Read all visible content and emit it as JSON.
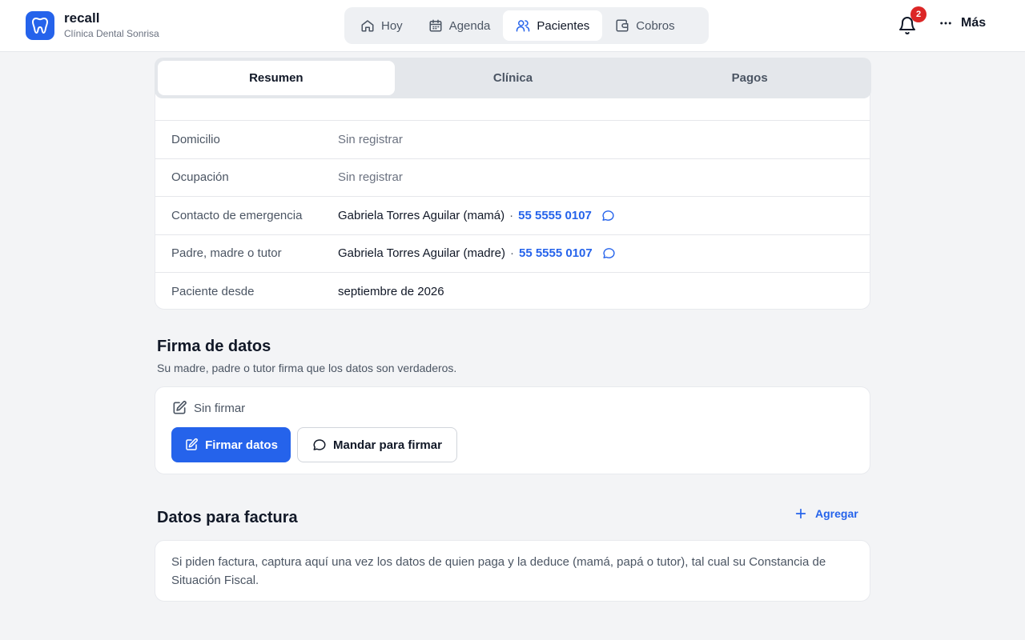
{
  "app": {
    "name": "recall",
    "clinic": "Clínica Dental Sonrisa",
    "logo_icon": "tooth-icon",
    "accent": "#2563eb"
  },
  "nav": {
    "items": [
      {
        "label": "Hoy",
        "icon": "home-icon"
      },
      {
        "label": "Agenda",
        "icon": "calendar-icon"
      },
      {
        "label": "Pacientes",
        "icon": "users-icon",
        "active": true
      },
      {
        "label": "Cobros",
        "icon": "wallet-icon"
      }
    ]
  },
  "header": {
    "notifications_count": "2",
    "more_label": "Más"
  },
  "tabs": [
    {
      "label": "Resumen",
      "active": true
    },
    {
      "label": "Clínica"
    },
    {
      "label": "Pagos"
    }
  ],
  "patient_info": {
    "rows": [
      {
        "label": "Domicilio",
        "value": "Sin registrar",
        "muted": true
      },
      {
        "label": "Ocupación",
        "value": "Sin registrar",
        "muted": true
      },
      {
        "label": "Contacto de emergencia",
        "value": "Gabriela Torres Aguilar (mamá)",
        "separator": "·",
        "phone": "55 5555 0107",
        "icon": "chat-icon"
      },
      {
        "label": "Padre, madre o tutor",
        "value": "Gabriela Torres Aguilar (madre)",
        "separator": "·",
        "phone": "55 5555 0107",
        "icon": "chat-icon"
      },
      {
        "label": "Paciente desde",
        "value": "septiembre de 2026"
      }
    ]
  },
  "signature": {
    "title": "Firma de datos",
    "subtitle": "Su madre, padre o tutor firma que los datos son verdaderos.",
    "status": "Sin firmar",
    "sign_button": "Firmar datos",
    "send_button": "Mandar para firmar"
  },
  "invoice": {
    "title": "Datos para factura",
    "add_label": "Agregar",
    "description": "Si piden factura, captura aquí una vez los datos de quien paga y la deduce (mamá, papá o tutor), tal cual su Constancia de Situación Fiscal."
  }
}
